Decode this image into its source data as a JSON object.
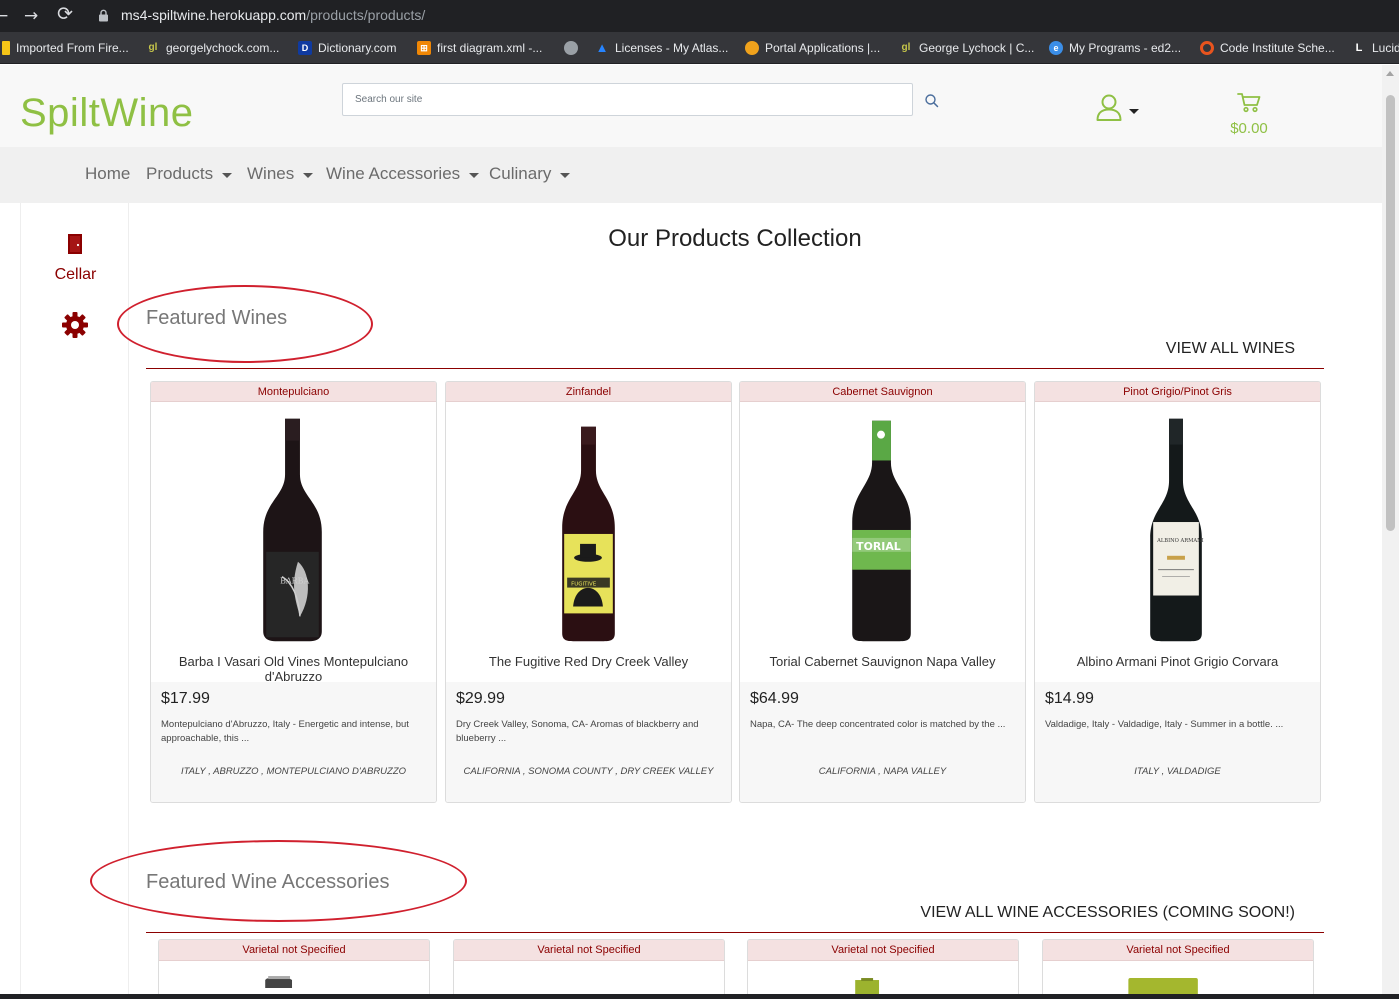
{
  "browser": {
    "back": "←",
    "forward": "→",
    "reload": "⟳",
    "url_host": "ms4-spiltwine.herokuapp.com",
    "url_path": "/products/products/",
    "bookmarks": [
      {
        "label": "Imported From Fire...",
        "icon": "folder-icon",
        "color": "#f5c518"
      },
      {
        "label": "georgelychock.com...",
        "icon": "gl-favicon-icon",
        "color": "#c6c64a"
      },
      {
        "label": "Dictionary.com",
        "icon": "dictionary-favicon-icon",
        "color": "#0f3aa0"
      },
      {
        "label": "first diagram.xml -...",
        "icon": "drawio-favicon-icon",
        "color": "#f08705"
      },
      {
        "label": "",
        "icon": "globe-icon",
        "color": "#9aa0a6"
      },
      {
        "label": "Licenses - My Atlas...",
        "icon": "atlassian-favicon-icon",
        "color": "#2684ff"
      },
      {
        "label": "Portal Applications |...",
        "icon": "portal-favicon-icon",
        "color": "#f0a21c"
      },
      {
        "label": "George Lychock | C...",
        "icon": "gl-favicon-icon",
        "color": "#c6c64a"
      },
      {
        "label": "My Programs - ed2...",
        "icon": "ed2go-favicon-icon",
        "color": "#3b8ee8"
      },
      {
        "label": "Code Institute Sche...",
        "icon": "code-institute-favicon-icon",
        "color": "#e8541e"
      },
      {
        "label": "Lucid",
        "icon": "lucid-favicon-icon",
        "color": "#ffffff"
      }
    ]
  },
  "header": {
    "logo": "SpiltWine",
    "search_placeholder": "Search our site",
    "cart_total": "$0.00"
  },
  "nav": {
    "items": [
      {
        "label": "Home",
        "dropdown": false
      },
      {
        "label": "Products",
        "dropdown": true
      },
      {
        "label": "Wines",
        "dropdown": true
      },
      {
        "label": "Wine Accessories",
        "dropdown": true
      },
      {
        "label": "Culinary",
        "dropdown": true
      }
    ]
  },
  "sidebar": {
    "cellar_label": "Cellar"
  },
  "main": {
    "page_title": "Our Products Collection",
    "featured_wines": {
      "title": "Featured Wines",
      "view_all": "VIEW ALL WINES",
      "products": [
        {
          "varietal": "Montepulciano",
          "name": "Barba I Vasari Old Vines Montepulciano d'Abruzzo",
          "price": "$17.99",
          "description": "Montepulciano d'Abruzzo, Italy - Energetic and intense, but approachable, this ...",
          "region": "ITALY , ABRUZZO , MONTEPULCIANO D'ABRUZZO",
          "bottle_label_color": "#2a2a2a",
          "bottle_label_text": "BARBA"
        },
        {
          "varietal": "Zinfandel",
          "name": "The Fugitive Red Dry Creek Valley",
          "price": "$29.99",
          "description": "Dry Creek Valley, Sonoma, CA- Aromas of blackberry and blueberry ...",
          "region": "CALIFORNIA , SONOMA COUNTY , DRY CREEK VALLEY",
          "bottle_label_color": "#e7e25a",
          "bottle_label_text": "FUGITIVE"
        },
        {
          "varietal": "Cabernet Sauvignon",
          "name": "Torial Cabernet Sauvignon Napa Valley",
          "price": "$64.99",
          "description": "Napa, CA- The deep concentrated color is matched by the ...",
          "region": "CALIFORNIA , NAPA VALLEY",
          "bottle_label_color": "#6fb84e",
          "bottle_label_text": "TORIAL"
        },
        {
          "varietal": "Pinot Grigio/Pinot Gris",
          "name": "Albino Armani Pinot Grigio Corvara",
          "price": "$14.99",
          "description": "Valdadige, Italy - Valdadige, Italy - Summer in a bottle. ...",
          "region": "ITALY , VALDADIGE",
          "bottle_label_color": "#f1efe6",
          "bottle_label_text": "ALBINO ARMANI"
        }
      ]
    },
    "featured_accessories": {
      "title": "Featured Wine Accessories",
      "view_all": "VIEW ALL WINE ACCESSORIES (COMING SOON!)",
      "products": [
        {
          "varietal": "Varietal not Specified"
        },
        {
          "varietal": "Varietal not Specified"
        },
        {
          "varietal": "Varietal not Specified"
        },
        {
          "varietal": "Varietal not Specified"
        }
      ]
    }
  },
  "colors": {
    "brand_green": "#8fc044",
    "brand_wine": "#8b0000",
    "annotation_red": "#d0202e"
  }
}
